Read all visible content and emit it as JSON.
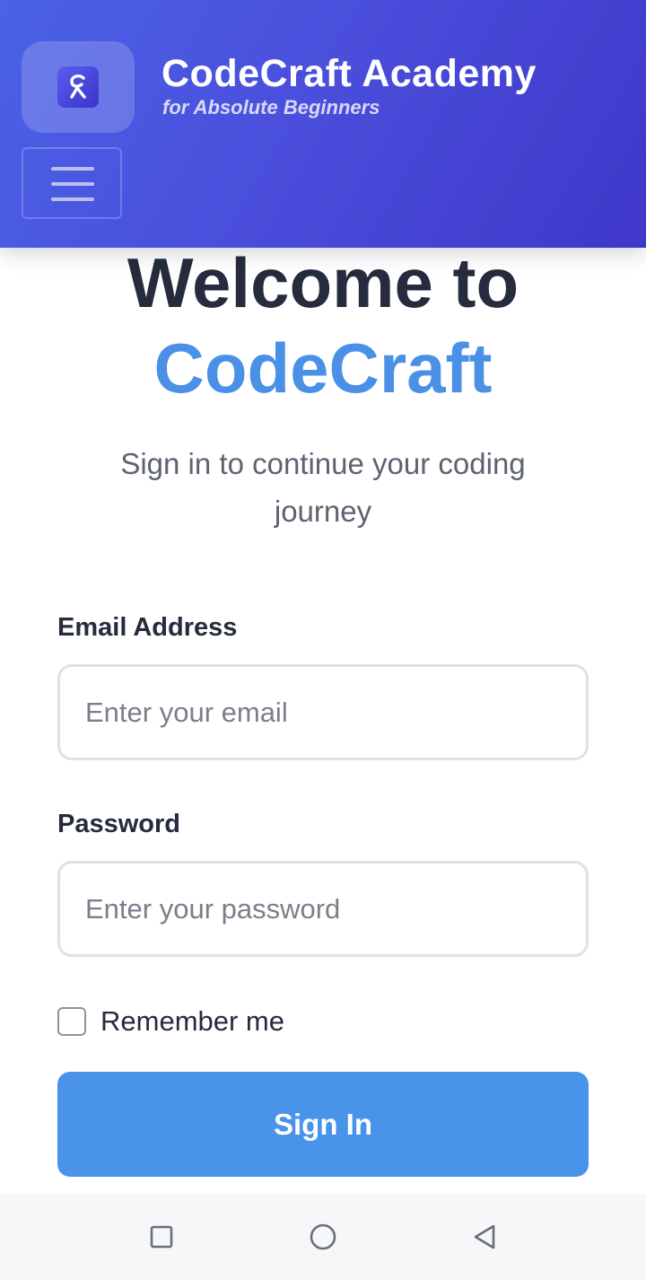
{
  "header": {
    "logo_icon": "code-craft-logo-icon",
    "title": "CodeCraft Academy",
    "subtitle": "for Absolute Beginners",
    "menu_icon": "hamburger-menu-icon"
  },
  "hero": {
    "line1": "Welcome to",
    "line2": "CodeCraft",
    "tagline": "Sign in to continue your coding journey"
  },
  "form": {
    "email": {
      "label": "Email Address",
      "placeholder": "Enter your email",
      "value": ""
    },
    "password": {
      "label": "Password",
      "placeholder": "Enter your password",
      "value": ""
    },
    "remember": {
      "label": "Remember me",
      "checked": false
    },
    "submit_label": "Sign In"
  },
  "system_nav": {
    "recents_icon": "square-recents-icon",
    "home_icon": "circle-home-icon",
    "back_icon": "triangle-back-icon"
  },
  "colors": {
    "header_gradient_start": "#4a62e6",
    "header_gradient_end": "#3f37c9",
    "accent": "#4a90e6",
    "button": "#4a93ea",
    "heading": "#262b3d",
    "muted_text": "#5d6370"
  }
}
